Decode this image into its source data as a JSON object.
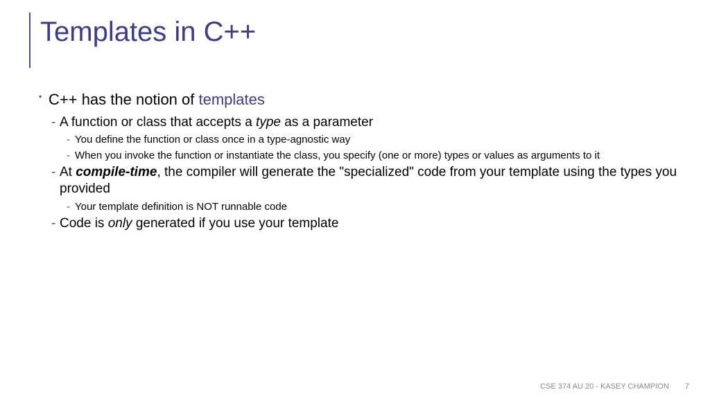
{
  "title": "Templates in C++",
  "bullets": {
    "main_pre": "C++ has the notion of ",
    "main_accent": "templates",
    "sub1_pre": "A function or class that accepts a ",
    "sub1_ital": "type",
    "sub1_post": " as a parameter",
    "sub1a": "You define the function or class once in a type-agnostic way",
    "sub1b": "When you invoke the function or instantiate the class, you specify (one or more) types or values as arguments to it",
    "sub2_pre": "At ",
    "sub2_bold": "compile-time",
    "sub2_post": ", the compiler will generate the \"specialized\" code from your template using the types you provided",
    "sub2a": "Your template definition is NOT runnable code",
    "sub3_pre": "Code is ",
    "sub3_ital": "only",
    "sub3_post": " generated if you use your template"
  },
  "footer": {
    "course": "CSE 374 AU 20 - KASEY CHAMPION",
    "page": "7"
  }
}
